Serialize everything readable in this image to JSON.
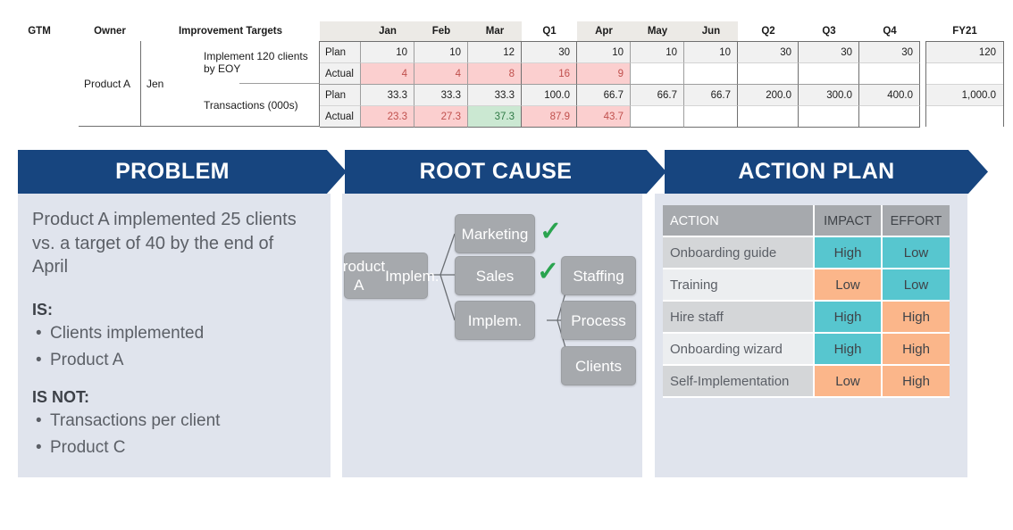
{
  "metric_table": {
    "headers": {
      "gtm": "GTM",
      "owner": "Owner",
      "improvement_targets": "Improvement Targets",
      "months": [
        "Jan",
        "Feb",
        "Mar"
      ],
      "q1": "Q1",
      "months2": [
        "Apr",
        "May",
        "Jun"
      ],
      "q2": "Q2",
      "q3": "Q3",
      "q4": "Q4",
      "fy": "FY21"
    },
    "gtm": "Product A",
    "owner": "Jen",
    "targets": [
      {
        "name": "Implement 120 clients by EOY",
        "plan": [
          "10",
          "10",
          "12",
          "30",
          "10",
          "10",
          "10",
          "30",
          "30",
          "30"
        ],
        "actual": [
          "4",
          "4",
          "8",
          "16",
          "9",
          "",
          "",
          "",
          "",
          ""
        ],
        "plan_fy": "120",
        "actual_fy": "",
        "actual_status": [
          "bad",
          "bad",
          "bad",
          "bad",
          "bad",
          "none",
          "none",
          "none",
          "none",
          "none"
        ]
      },
      {
        "name": "Transactions (000s)",
        "plan": [
          "33.3",
          "33.3",
          "33.3",
          "100.0",
          "66.7",
          "66.7",
          "66.7",
          "200.0",
          "300.0",
          "400.0"
        ],
        "actual": [
          "23.3",
          "27.3",
          "37.3",
          "87.9",
          "43.7",
          "",
          "",
          "",
          "",
          ""
        ],
        "plan_fy": "1,000.0",
        "actual_fy": "",
        "actual_status": [
          "bad",
          "bad",
          "good",
          "bad",
          "bad",
          "none",
          "none",
          "none",
          "none",
          "none"
        ]
      }
    ],
    "row_labels": {
      "plan": "Plan",
      "actual": "Actual"
    }
  },
  "banner": {
    "problem": "PROBLEM",
    "root_cause": "ROOT CAUSE",
    "action_plan": "ACTION PLAN",
    "color": "#17457f"
  },
  "problem": {
    "lead": "Product A implemented 25 clients vs. a target of 40 by the end of April",
    "is_label": "IS:",
    "is_items": [
      "Clients implemented",
      "Product A"
    ],
    "is_not_label": "IS NOT:",
    "is_not_items": [
      "Transactions per client",
      "Product C"
    ],
    "bullet": "•"
  },
  "root_cause": {
    "nodes": {
      "root": "Product A Implem.",
      "root_line1": "Product A",
      "root_line2": "Implem.",
      "marketing": "Marketing",
      "sales": "Sales",
      "implem": "Implem.",
      "staffing": "Staffing",
      "process": "Process",
      "clients": "Clients"
    },
    "checks": [
      "✓",
      "✓"
    ],
    "check_color": "#2aa44f"
  },
  "action_plan": {
    "columns": [
      "ACTION",
      "IMPACT",
      "EFFORT"
    ],
    "rows": [
      {
        "action": "Onboarding guide",
        "impact": "High",
        "effort": "Low",
        "impact_level": "high",
        "effort_level": "low"
      },
      {
        "action": "Training",
        "impact": "Low",
        "effort": "Low",
        "impact_level": "low",
        "effort_level": "low"
      },
      {
        "action": "Hire staff",
        "impact": "High",
        "effort": "High",
        "impact_level": "high",
        "effort_level": "high"
      },
      {
        "action": "Onboarding wizard",
        "impact": "High",
        "effort": "High",
        "impact_level": "high",
        "effort_level": "high"
      },
      {
        "action": "Self-Implementation",
        "impact": "Low",
        "effort": "High",
        "impact_level": "low",
        "effort_level": "high"
      }
    ],
    "colors": {
      "teal": "#57c6cf",
      "orange": "#fbb68a",
      "header": "#a6a9ad"
    }
  }
}
